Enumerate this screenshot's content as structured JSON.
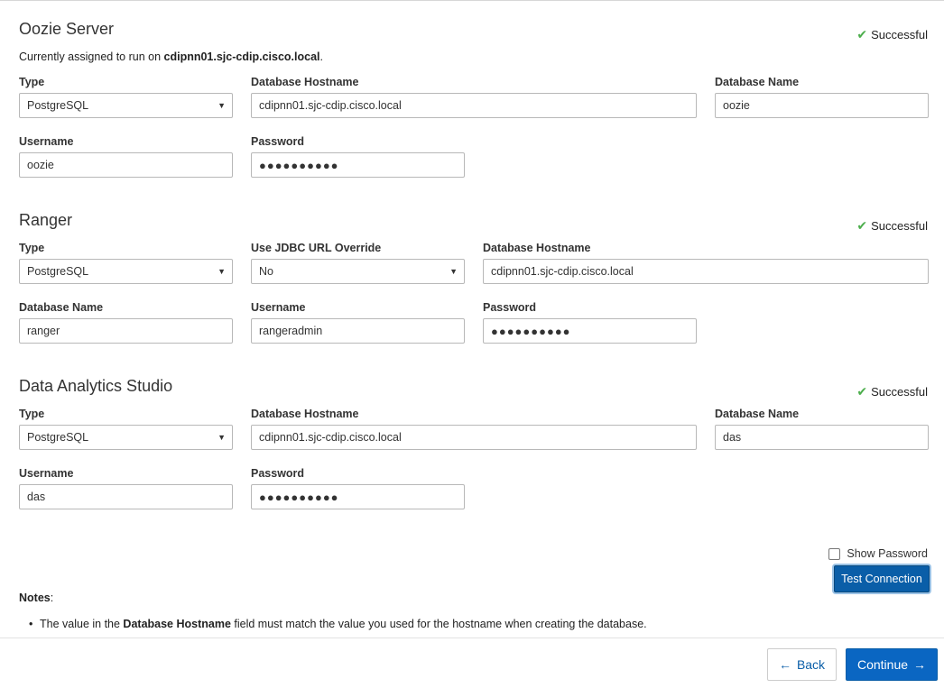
{
  "status_icon": "check-icon",
  "oozie": {
    "title": "Oozie Server",
    "status": "Successful",
    "assigned_prefix": "Currently assigned to run on ",
    "assigned_host": "cdipnn01.sjc-cdip.cisco.local",
    "assigned_suffix": ".",
    "type_label": "Type",
    "type_value": "PostgreSQL",
    "hostname_label": "Database Hostname",
    "hostname_value": "cdipnn01.sjc-cdip.cisco.local",
    "dbname_label": "Database Name",
    "dbname_value": "oozie",
    "username_label": "Username",
    "username_value": "oozie",
    "password_label": "Password",
    "password_value": "●●●●●●●●●●"
  },
  "ranger": {
    "title": "Ranger",
    "status": "Successful",
    "type_label": "Type",
    "type_value": "PostgreSQL",
    "jdbc_label": "Use JDBC URL Override",
    "jdbc_value": "No",
    "hostname_label": "Database Hostname",
    "hostname_value": "cdipnn01.sjc-cdip.cisco.local",
    "dbname_label": "Database Name",
    "dbname_value": "ranger",
    "username_label": "Username",
    "username_value": "rangeradmin",
    "password_label": "Password",
    "password_value": "●●●●●●●●●●"
  },
  "das": {
    "title": "Data Analytics Studio",
    "status": "Successful",
    "type_label": "Type",
    "type_value": "PostgreSQL",
    "hostname_label": "Database Hostname",
    "hostname_value": "cdipnn01.sjc-cdip.cisco.local",
    "dbname_label": "Database Name",
    "dbname_value": "das",
    "username_label": "Username",
    "username_value": "das",
    "password_label": "Password",
    "password_value": "●●●●●●●●●●"
  },
  "show_password_label": "Show Password",
  "show_password_checked": false,
  "test_connection_label": "Test Connection",
  "notes": {
    "heading": "Notes",
    "heading_suffix": ":",
    "item1_prefix": "The value in the ",
    "item1_bold": "Database Hostname",
    "item1_suffix": " field must match the value you used for the hostname when creating the database."
  },
  "footer": {
    "back_label": "Back",
    "back_icon": "arrow-left-icon",
    "continue_label": "Continue",
    "continue_icon": "arrow-right-icon"
  }
}
